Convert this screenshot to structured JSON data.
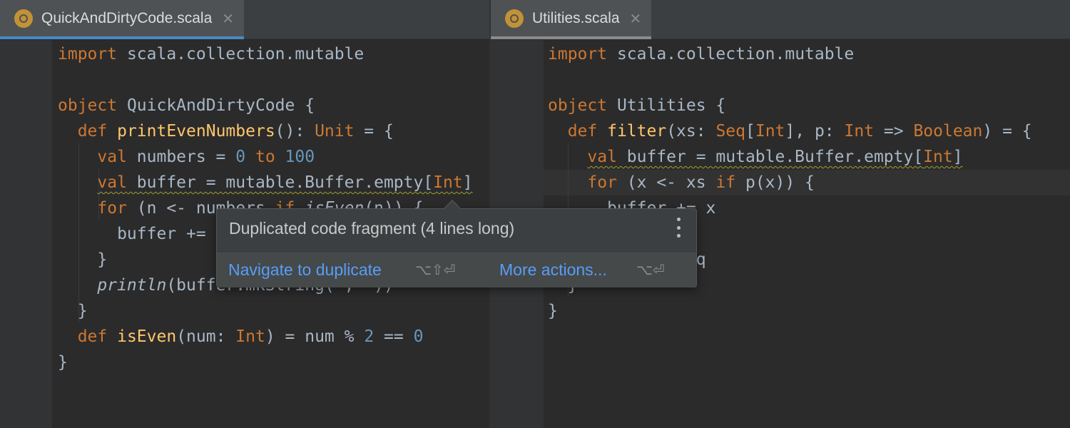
{
  "editor_left": {
    "tab": {
      "label": "QuickAndDirtyCode.scala",
      "close_glyph": "✕",
      "icon": "scala-object-icon",
      "state": "active"
    },
    "lines": [
      [
        {
          "t": "import",
          "c": "kw"
        },
        {
          "t": " scala.collection.mutable"
        }
      ],
      [],
      [
        {
          "t": "object",
          "c": "kw"
        },
        {
          "t": " QuickAndDirtyCode {"
        }
      ],
      [
        {
          "t": "  "
        },
        {
          "t": "def",
          "c": "kw"
        },
        {
          "t": " "
        },
        {
          "t": "printEvenNumbers",
          "c": "fn"
        },
        {
          "t": "(): "
        },
        {
          "t": "Unit",
          "c": "typ"
        },
        {
          "t": " = {"
        }
      ],
      [
        {
          "t": "    "
        },
        {
          "t": "val",
          "c": "kw"
        },
        {
          "t": " numbers = "
        },
        {
          "t": "0",
          "c": "num"
        },
        {
          "t": " "
        },
        {
          "t": "to",
          "c": "kw"
        },
        {
          "t": " "
        },
        {
          "t": "100",
          "c": "num"
        }
      ],
      [
        {
          "t": "    "
        },
        {
          "t": "val",
          "c": "kw wavy"
        },
        {
          "t": " buffer = mutable.Buffer.empty[",
          "c": "wavy"
        },
        {
          "t": "Int",
          "c": "typ wavy"
        },
        {
          "t": "]",
          "c": "wavy"
        }
      ],
      [
        {
          "t": "    "
        },
        {
          "t": "for",
          "c": "kw"
        },
        {
          "t": " (n <- numbers "
        },
        {
          "t": "if",
          "c": "kw"
        },
        {
          "t": " "
        },
        {
          "t": "isEven",
          "c": "it"
        },
        {
          "t": "(n)) {"
        }
      ],
      [
        {
          "t": "      buffer += n"
        }
      ],
      [
        {
          "t": "    }"
        }
      ],
      [
        {
          "t": "    "
        },
        {
          "t": "println",
          "c": "it"
        },
        {
          "t": "(buffer.mkString(\", \"))"
        }
      ],
      [
        {
          "t": "  }"
        }
      ],
      [
        {
          "t": "  "
        },
        {
          "t": "def",
          "c": "kw"
        },
        {
          "t": " "
        },
        {
          "t": "isEven",
          "c": "fn"
        },
        {
          "t": "(num: "
        },
        {
          "t": "Int",
          "c": "typ"
        },
        {
          "t": ") = num % "
        },
        {
          "t": "2",
          "c": "num"
        },
        {
          "t": " == "
        },
        {
          "t": "0",
          "c": "num"
        }
      ],
      [
        {
          "t": "}"
        }
      ]
    ]
  },
  "editor_right": {
    "tab": {
      "label": "Utilities.scala",
      "close_glyph": "✕",
      "icon": "scala-object-icon",
      "state": "inactive"
    },
    "lines": [
      [
        {
          "t": "import",
          "c": "kw"
        },
        {
          "t": " scala.collection.mutable"
        }
      ],
      [],
      [
        {
          "t": "object",
          "c": "kw"
        },
        {
          "t": " Utilities {"
        }
      ],
      [
        {
          "t": "  "
        },
        {
          "t": "def",
          "c": "kw"
        },
        {
          "t": " "
        },
        {
          "t": "filter",
          "c": "fn"
        },
        {
          "t": "(xs: "
        },
        {
          "t": "Seq",
          "c": "typ"
        },
        {
          "t": "["
        },
        {
          "t": "Int",
          "c": "typ"
        },
        {
          "t": "], p: "
        },
        {
          "t": "Int",
          "c": "typ"
        },
        {
          "t": " => "
        },
        {
          "t": "Boolean",
          "c": "typ"
        },
        {
          "t": ") = {"
        }
      ],
      [
        {
          "t": "    "
        },
        {
          "t": "val",
          "c": "kw wavy"
        },
        {
          "t": " buffer = mutable.Buffer.empty[",
          "c": "wavy"
        },
        {
          "t": "Int",
          "c": "typ wavy"
        },
        {
          "t": "]",
          "c": "wavy"
        }
      ],
      [
        {
          "t": "    "
        },
        {
          "t": "for",
          "c": "kw"
        },
        {
          "t": " (x <- xs "
        },
        {
          "t": "if",
          "c": "kw"
        },
        {
          "t": " p(x)) {"
        }
      ],
      [
        {
          "t": "      buffer += x"
        }
      ],
      [
        {
          "t": "    }"
        }
      ],
      [
        {
          "t": "    buffer.toSeq"
        }
      ],
      [
        {
          "t": "  }"
        }
      ],
      [
        {
          "t": "}"
        }
      ]
    ]
  },
  "popup": {
    "title": "Duplicated code fragment (4 lines long)",
    "menu_icon": "more-vertical-icon",
    "actions": [
      {
        "label": "Navigate to duplicate",
        "shortcut": "⌥⇧⏎"
      },
      {
        "label": "More actions...",
        "shortcut": "⌥⏎"
      }
    ]
  },
  "colors": {
    "keyword": "#cc7832",
    "function": "#ffc66d",
    "number": "#6897bb",
    "text": "#a9b7c6",
    "link": "#589df6",
    "background": "#2b2b2b"
  }
}
